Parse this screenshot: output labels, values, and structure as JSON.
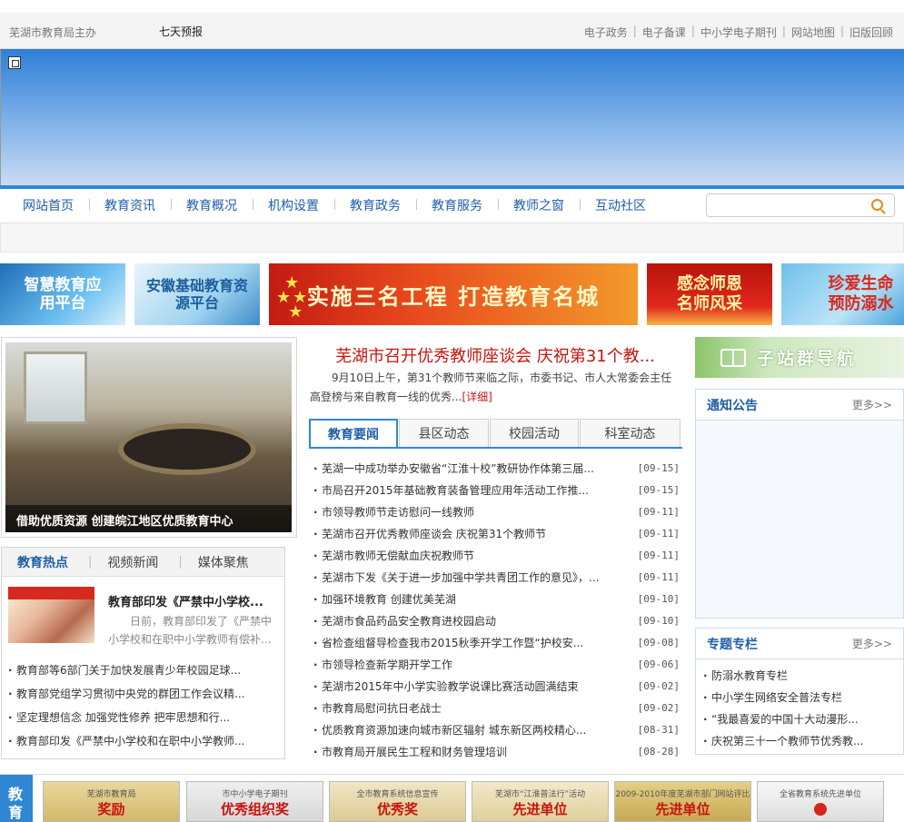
{
  "topbar": {
    "host": "芜湖市教育局主办",
    "weather": "七天预报",
    "links": [
      "电子政务",
      "电子备课",
      "中小学电子期刊",
      "网站地图",
      "旧版回顾"
    ]
  },
  "nav": {
    "items": [
      "网站首页",
      "教育资讯",
      "教育概况",
      "机构设置",
      "教育政务",
      "教育服务",
      "教师之窗",
      "互动社区"
    ],
    "search_placeholder": ""
  },
  "ads": {
    "ad1": "智慧教育应用平台",
    "ad2": "安徽基础教育资源平台",
    "ad3": "实施三名工程 打造教育名城",
    "ad4": "感念师恩名师风采",
    "ad5": "珍爱生命预防溺水"
  },
  "focus": {
    "caption": "借助优质资源 创建皖江地区优质教育中心"
  },
  "hot": {
    "tabs": [
      "教育热点",
      "视频新闻",
      "媒体聚焦"
    ],
    "feature_title": "教育部印发《严禁中小学校...",
    "feature_desc": "日前，教育部印发了《严禁中小学校和在职中小学教师有偿补...",
    "items": [
      "教育部等6部门关于加快发展青少年校园足球...",
      "教育部党组学习贯彻中央党的群团工作会议精...",
      "坚定理想信念 加强党性修养 把牢思想和行...",
      "教育部印发《严禁中小学校和在职中小学教师..."
    ]
  },
  "headline": {
    "title": "芜湖市召开优秀教师座谈会 庆祝第31个教...",
    "summary": "9月10日上午，第31个教师节来临之际，市委书记、市人大常委会主任高登榜与来自教育一线的优秀...",
    "more": "[详细]"
  },
  "news": {
    "tabs": [
      "教育要闻",
      "县区动态",
      "校园活动",
      "科室动态"
    ],
    "items": [
      {
        "title": "芜湖一中成功举办安徽省“江淮十校”教研协作体第三届...",
        "date": "[09-15]"
      },
      {
        "title": "市局召开2015年基础教育装备管理应用年活动工作推...",
        "date": "[09-15]"
      },
      {
        "title": "市领导教师节走访慰问一线教师",
        "date": "[09-11]"
      },
      {
        "title": "芜湖市召开优秀教师座谈会 庆祝第31个教师节",
        "date": "[09-11]"
      },
      {
        "title": "芜湖市教师无偿献血庆祝教师节",
        "date": "[09-11]"
      },
      {
        "title": "芜湖市下发《关于进一步加强中学共青团工作的意见》，...",
        "date": "[09-11]"
      },
      {
        "title": "加强环境教育 创建优美芜湖",
        "date": "[09-10]"
      },
      {
        "title": "芜湖市食品药品安全教育进校园启动",
        "date": "[09-10]"
      },
      {
        "title": "省检查组督导检查我市2015秋季开学工作暨“护校安...",
        "date": "[09-08]"
      },
      {
        "title": "市领导检查新学期开学工作",
        "date": "[09-06]"
      },
      {
        "title": "芜湖市2015年中小学实验教学说课比赛活动圆满结束",
        "date": "[09-02]"
      },
      {
        "title": "市教育局慰问抗日老战士",
        "date": "[09-02]"
      },
      {
        "title": "优质教育资源加速向城市新区辐射 城东新区两校精心...",
        "date": "[08-31]"
      },
      {
        "title": "市教育局开展民生工程和财务管理培训",
        "date": "[08-28]"
      }
    ]
  },
  "right": {
    "station_nav": "子站群导航",
    "notice_title": "通知公告",
    "notice_more": "更多>>",
    "topic_title": "专题专栏",
    "topic_more": "更多>>",
    "topics": [
      "防溺水教育专栏",
      "中小学生网络安全普法专栏",
      "“我最喜爱的中国十大动漫形...",
      "庆祝第三十一个教师节优秀教..."
    ]
  },
  "bottom": {
    "label": "教育",
    "certs": [
      {
        "big": "奖励",
        "small": "芜湖市教育局"
      },
      {
        "big": "优秀组织奖",
        "small": "市中小学电子期刊"
      },
      {
        "big": "优秀奖",
        "small": "全市教育系统信息宣传"
      },
      {
        "big": "先进单位",
        "small": "芜湖市“江淮普法行”活动"
      },
      {
        "big": "先进单位",
        "small": "2009-2010年度芜湖市部门网站评比"
      },
      {
        "big": "",
        "small": "全省教育系统先进单位"
      }
    ]
  }
}
